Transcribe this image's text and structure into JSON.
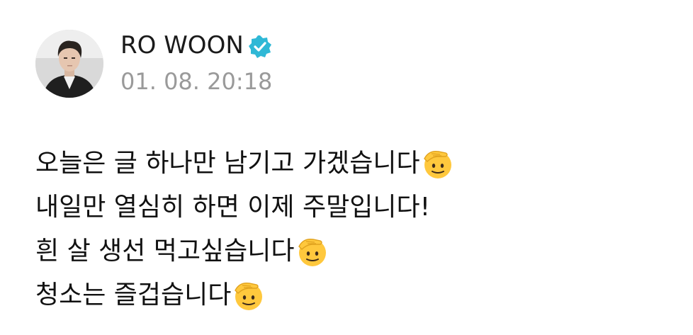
{
  "post": {
    "author": {
      "name": "RO WOON",
      "verified": true,
      "verified_icon": "verified-badge-icon",
      "avatar": "profile-photo"
    },
    "timestamp": "01. 08. 20:18",
    "lines": [
      {
        "text": "오늘은 글 하나만 남기고 가겠습니다",
        "emoji": "saluting-face-icon"
      },
      {
        "text": "내일만 열심히 하면 이제 주말입니다!",
        "emoji": ""
      },
      {
        "text": "흰 살 생선 먹고싶습니다",
        "emoji": "saluting-face-icon"
      },
      {
        "text": "청소는 즐겁습니다",
        "emoji": "saluting-face-icon"
      }
    ]
  },
  "colors": {
    "text": "#111111",
    "timestamp": "#9a9a9a",
    "verified": "#2fb8d6",
    "background": "#ffffff"
  }
}
